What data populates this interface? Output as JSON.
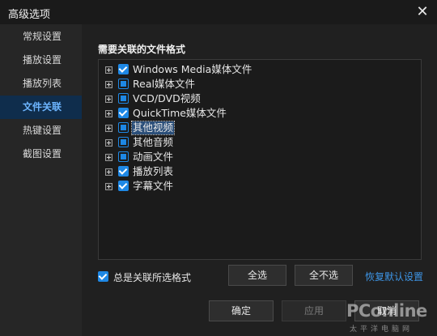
{
  "window": {
    "title": "高级选项",
    "close_icon": "close-icon"
  },
  "sidebar": {
    "items": [
      {
        "label": "常规设置",
        "active": false
      },
      {
        "label": "播放设置",
        "active": false
      },
      {
        "label": "播放列表",
        "active": false
      },
      {
        "label": "文件关联",
        "active": true
      },
      {
        "label": "热键设置",
        "active": false
      },
      {
        "label": "截图设置",
        "active": false
      }
    ]
  },
  "main": {
    "section_title": "需要关联的文件格式",
    "formats": [
      {
        "label": "Windows Media媒体文件",
        "state": "checked",
        "selected": false
      },
      {
        "label": "Real媒体文件",
        "state": "partial",
        "selected": false
      },
      {
        "label": "VCD/DVD视频",
        "state": "partial",
        "selected": false
      },
      {
        "label": "QuickTime媒体文件",
        "state": "checked",
        "selected": false
      },
      {
        "label": "其他视频",
        "state": "partial",
        "selected": true
      },
      {
        "label": "其他音频",
        "state": "partial",
        "selected": false
      },
      {
        "label": "动画文件",
        "state": "partial",
        "selected": false
      },
      {
        "label": "播放列表",
        "state": "checked",
        "selected": false
      },
      {
        "label": "字幕文件",
        "state": "checked",
        "selected": false
      }
    ],
    "always_associate": {
      "label": "总是关联所选格式",
      "checked": true
    },
    "select_all_label": "全选",
    "select_none_label": "全不选",
    "restore_defaults_label": "恢复默认设置"
  },
  "footer": {
    "ok_label": "确定",
    "apply_label": "应用",
    "cancel_label": "取消"
  },
  "watermark": {
    "brand": "PConline",
    "sub": "太平洋电脑网"
  },
  "colors": {
    "accent": "#1e88e5",
    "active_nav_bg": "#0f2d4c",
    "active_nav_text": "#6db5ff",
    "link": "#3d95e6"
  }
}
